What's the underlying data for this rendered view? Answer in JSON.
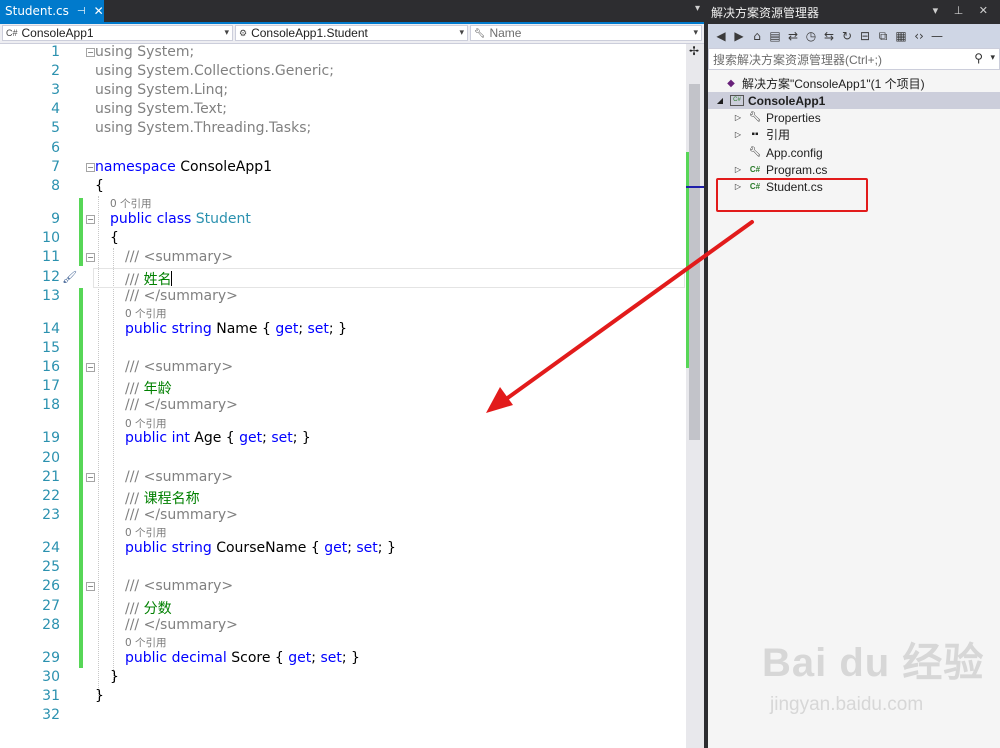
{
  "tab": {
    "title": "Student.cs",
    "pin": "⊣",
    "close": "✕"
  },
  "nav": {
    "project": "ConsoleApp1",
    "class": "ConsoleApp1.Student",
    "member_placeholder": "Name"
  },
  "editor": {
    "line_numbers": [
      "1",
      "2",
      "3",
      "4",
      "5",
      "6",
      "7",
      "8",
      "9",
      "10",
      "11",
      "12",
      "13",
      "14",
      "15",
      "16",
      "17",
      "18",
      "19",
      "20",
      "21",
      "22",
      "23",
      "24",
      "25",
      "26",
      "27",
      "28",
      "29",
      "30",
      "31",
      "32"
    ],
    "usings": {
      "kw": "using",
      "names": [
        "System;",
        "System.Collections.Generic;",
        "System.Linq;",
        "System.Text;",
        "System.Threading.Tasks;"
      ]
    },
    "ns_kw": "namespace",
    "ns_name": "ConsoleApp1",
    "brace_open": "{",
    "brace_close": "}",
    "ref_lens": "0 个引用",
    "class_kw": "public class",
    "class_name": "Student",
    "summary_open": "/// <summary>",
    "summary_close": "/// </summary>",
    "doc_prefix": "/// ",
    "members": [
      {
        "doc": "姓名",
        "kw": "public string",
        "name": "Name"
      },
      {
        "doc": "年龄",
        "kw": "public int",
        "name": "Age"
      },
      {
        "doc": "课程名称",
        "kw": "public string",
        "name": "CourseName"
      },
      {
        "doc": "分数",
        "kw": "public decimal",
        "name": "Score"
      }
    ],
    "acc_open": " { ",
    "get_kw": "get",
    "semi": "; ",
    "set_kw": "set",
    "acc_close": "; }"
  },
  "solution_explorer": {
    "title": "解决方案资源管理器",
    "title_buttons": "▾ ⊥ ✕",
    "search_placeholder": "搜索解决方案资源管理器(Ctrl+;)",
    "tree": {
      "solution": "解决方案\"ConsoleApp1\"(1 个项目)",
      "project": "ConsoleApp1",
      "properties": "Properties",
      "references": "引用",
      "appconfig": "App.config",
      "program": "Program.cs",
      "student": "Student.cs"
    }
  },
  "watermark": {
    "brand": "Bai du 经验",
    "url": "jingyan.baidu.com"
  },
  "colors": {
    "accent": "#007acc",
    "keyword": "#0000ff",
    "type": "#2b91af",
    "comment": "#008000",
    "change_bar": "#57d657",
    "annotation": "#e21b1b"
  }
}
